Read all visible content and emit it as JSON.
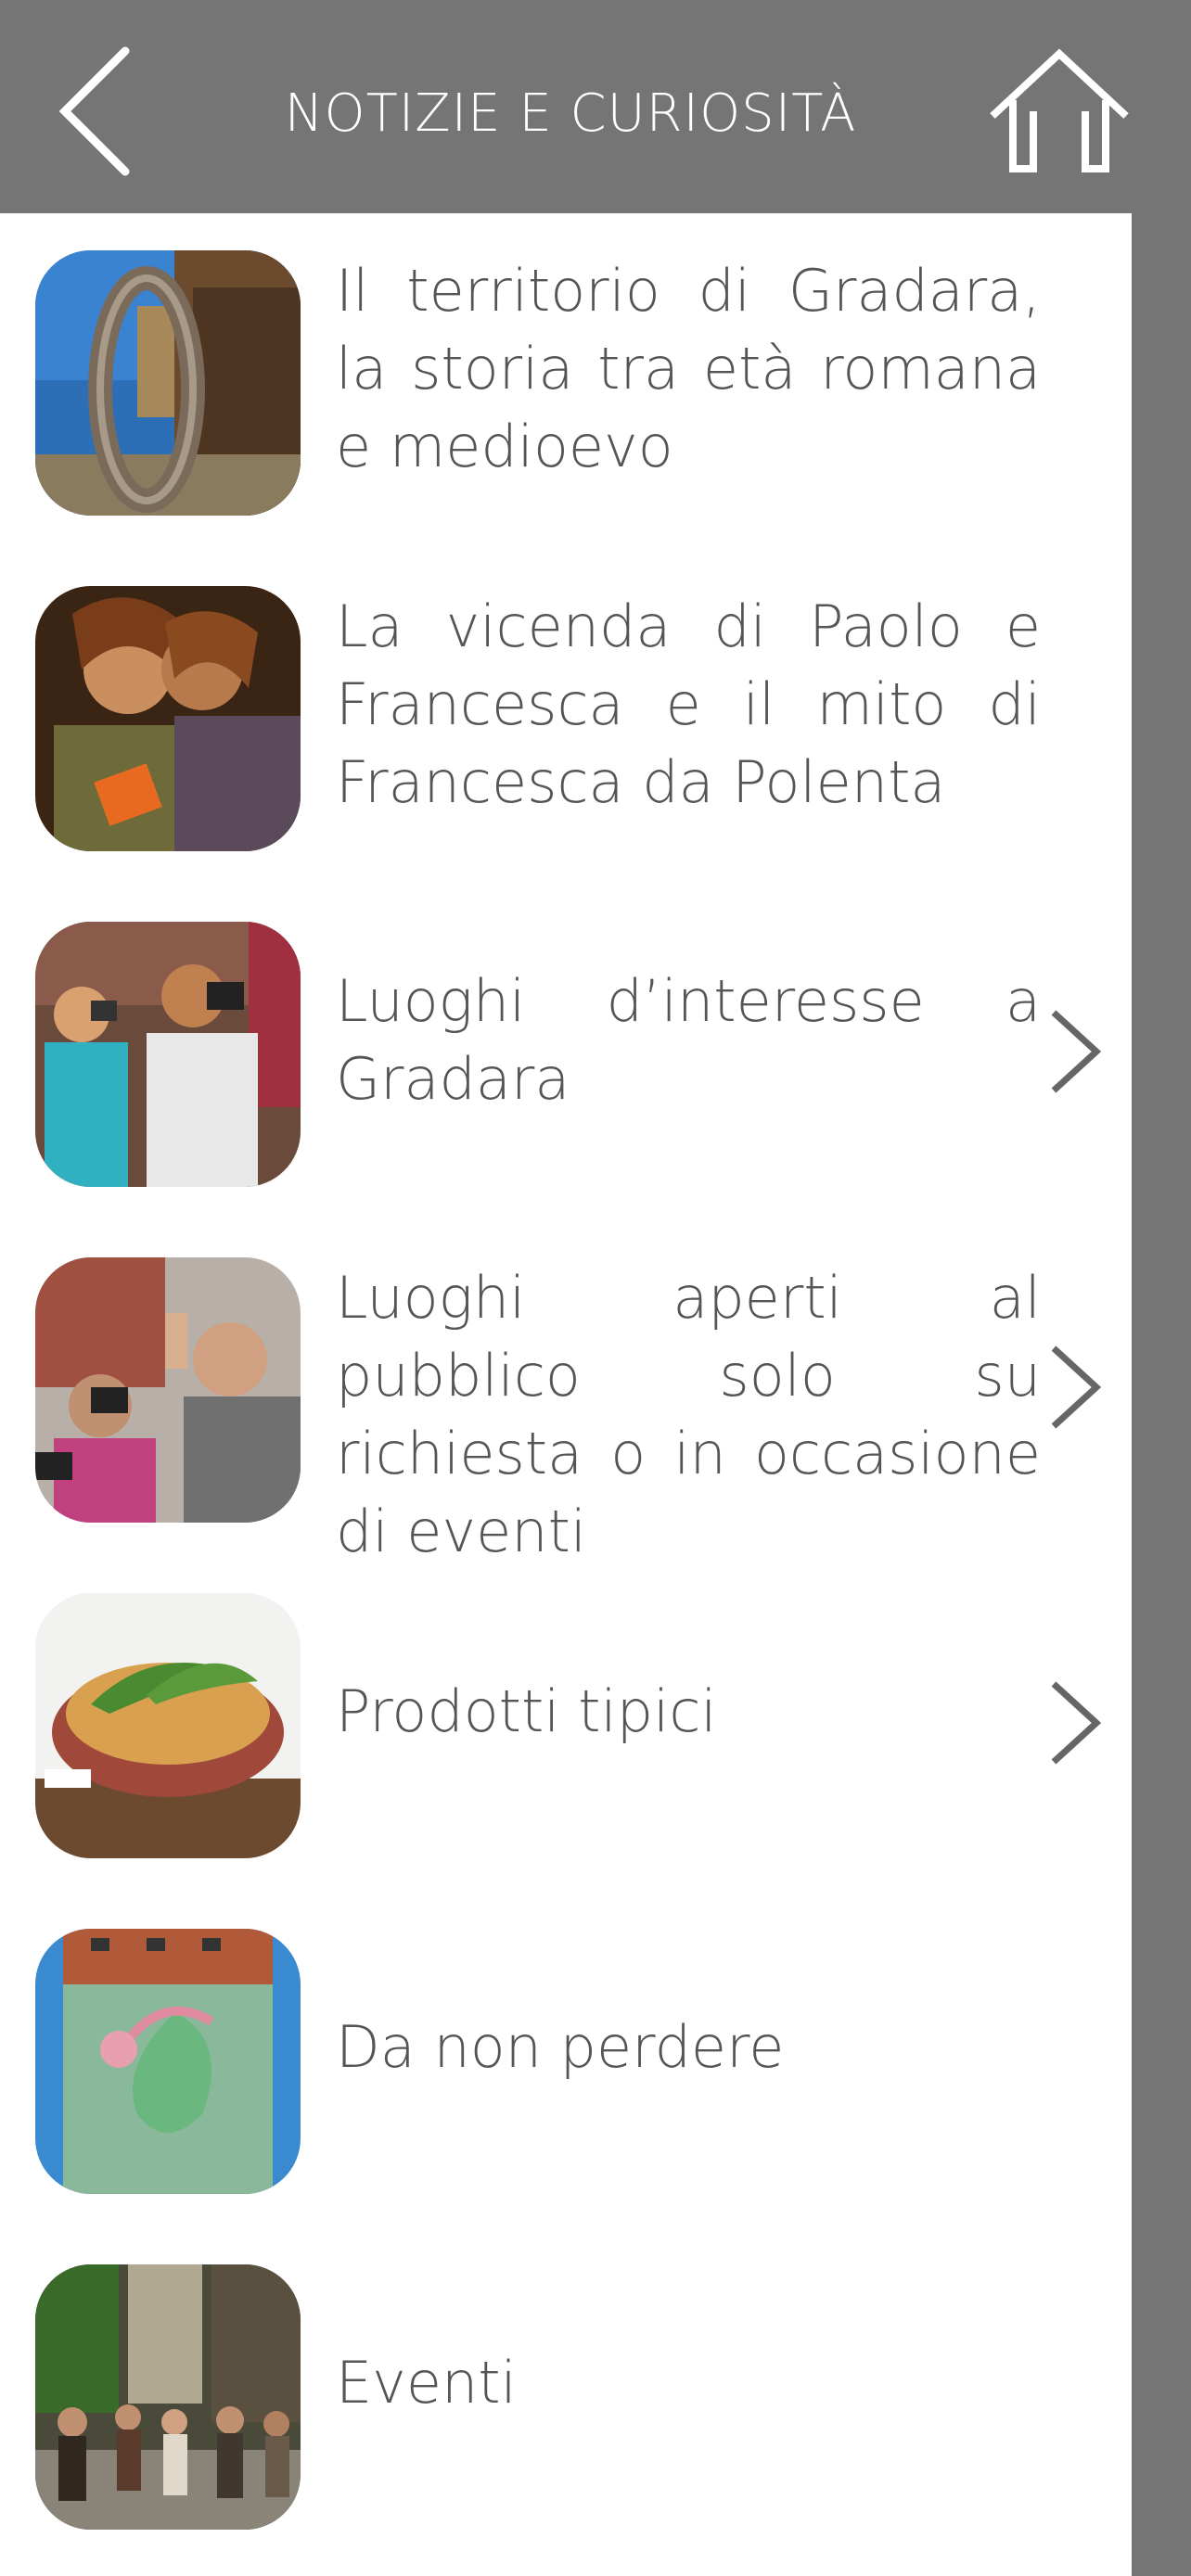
{
  "header": {
    "title": "NOTIZIE E CURIOSITÀ",
    "back_icon": "chevron-left-icon",
    "home_icon": "home-icon"
  },
  "colors": {
    "header_bg": "#757575",
    "title_text": "#ffffff",
    "list_bg": "#ffffff",
    "item_text": "#555555",
    "chevron": "#666666"
  },
  "items": [
    {
      "label": "Il territorio di Gradara, la storia tra età romana e medioevo",
      "thumbnail": "castle-ring-photo",
      "has_chevron": false
    },
    {
      "label": "La vicenda di Paolo e Francesca e il mito di Francesca da Polenta",
      "thumbnail": "paolo-francesca-photo",
      "has_chevron": false
    },
    {
      "label": "Luoghi d’interesse a Gradara",
      "thumbnail": "tourists-photographing-photo",
      "has_chevron": true
    },
    {
      "label": "Luoghi aperti al pubblico solo su richiesta o in occasione di eventi",
      "thumbnail": "crowd-cameras-photo",
      "has_chevron": true
    },
    {
      "label": "Prodotti tipici",
      "thumbnail": "pasta-dish-photo",
      "has_chevron": true
    },
    {
      "label": "Da non perdere",
      "thumbnail": "tower-mural-photo",
      "has_chevron": false
    },
    {
      "label": "Eventi",
      "thumbnail": "medieval-parade-photo",
      "has_chevron": false
    }
  ]
}
